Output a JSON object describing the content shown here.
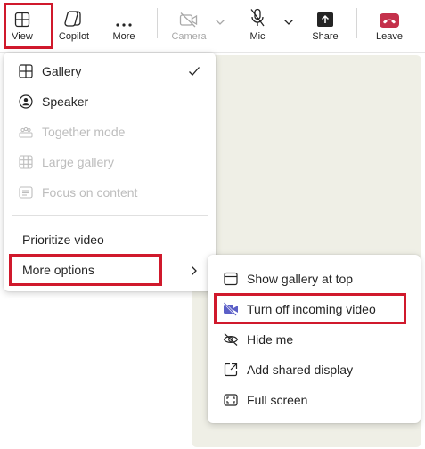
{
  "toolbar": {
    "view": {
      "label": "View",
      "icon": "view-grid-icon"
    },
    "copilot": {
      "label": "Copilot",
      "icon": "copilot-icon"
    },
    "more": {
      "label": "More",
      "icon": "more-horizontal-icon"
    },
    "camera": {
      "label": "Camera",
      "icon": "camera-off-icon",
      "state": "disabled"
    },
    "mic": {
      "label": "Mic",
      "icon": "mic-off-icon"
    },
    "share": {
      "label": "Share",
      "icon": "share-screen-icon"
    },
    "leave": {
      "label": "Leave",
      "icon": "hang-up-icon",
      "color": "#c4314b"
    }
  },
  "view_menu": {
    "layouts": [
      {
        "label": "Gallery",
        "icon": "gallery-icon",
        "checked": true,
        "enabled": true
      },
      {
        "label": "Speaker",
        "icon": "speaker-icon",
        "enabled": true
      },
      {
        "label": "Together mode",
        "icon": "together-mode-icon",
        "enabled": false
      },
      {
        "label": "Large gallery",
        "icon": "large-gallery-icon",
        "enabled": false
      },
      {
        "label": "Focus on content",
        "icon": "focus-content-icon",
        "enabled": false
      }
    ],
    "prioritize_video": "Prioritize video",
    "more_options": "More options"
  },
  "more_options_menu": [
    {
      "label": "Show gallery at top",
      "icon": "gallery-top-icon"
    },
    {
      "label": "Turn off incoming video",
      "icon": "video-off-icon",
      "icon_color": "#5b5fc7",
      "highlighted": true
    },
    {
      "label": "Hide me",
      "icon": "eye-off-icon"
    },
    {
      "label": "Add shared display",
      "icon": "shared-display-icon"
    },
    {
      "label": "Full screen",
      "icon": "full-screen-icon"
    }
  ],
  "colors": {
    "highlight_box": "#d0192c",
    "leave": "#c4314b",
    "accent": "#5b5fc7"
  }
}
